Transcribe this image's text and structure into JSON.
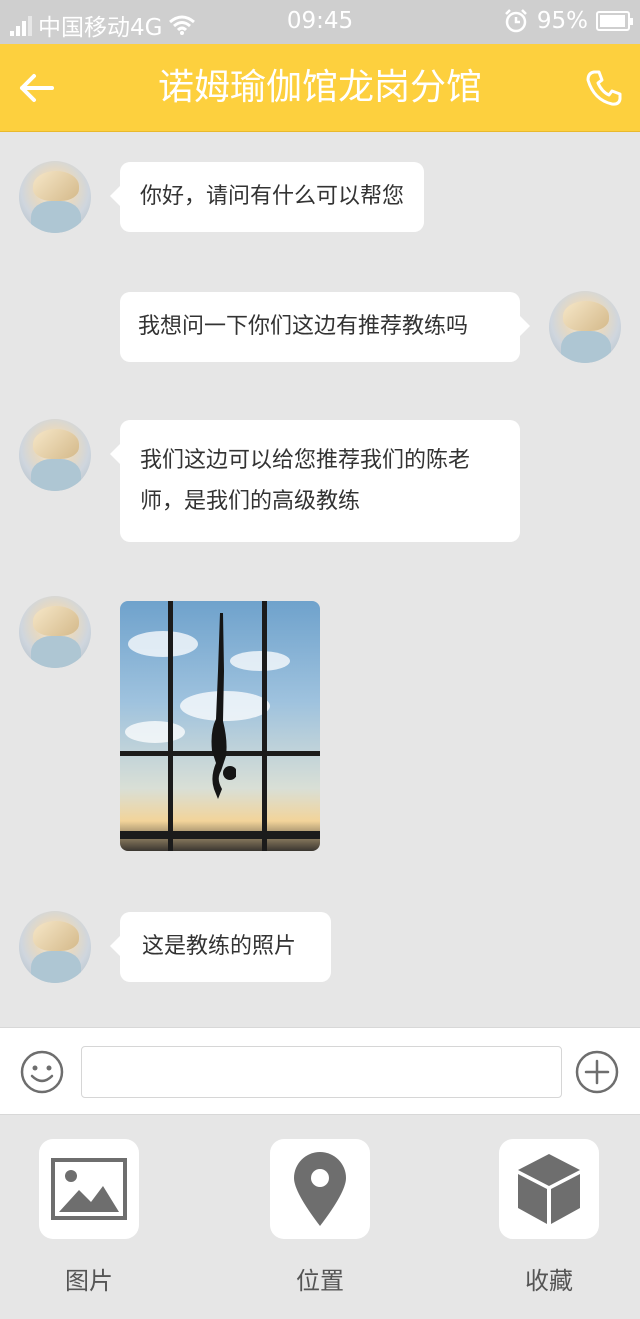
{
  "status_bar": {
    "carrier": "中国移动4G",
    "time": "09:45",
    "battery": "95%",
    "battery_level": 0.95
  },
  "header": {
    "title": "诺姆瑜伽馆龙岗分馆",
    "back_icon": "arrow-left-icon",
    "call_icon": "phone-icon"
  },
  "messages": [
    {
      "side": "left",
      "type": "text",
      "text": "你好，请问有什么可以帮您"
    },
    {
      "side": "right",
      "type": "text",
      "text": "我想问一下你们这边有推荐教练吗"
    },
    {
      "side": "left",
      "type": "text",
      "text": "我们这边可以给您推荐我们的陈老师，是我们的高级教练"
    },
    {
      "side": "left",
      "type": "image",
      "image": "yoga-handstand-photo"
    },
    {
      "side": "left",
      "type": "text",
      "text": "这是教练的照片"
    }
  ],
  "input_bar": {
    "emoji_icon": "smiley-icon",
    "value": "",
    "plus_icon": "plus-circle-icon"
  },
  "tray": [
    {
      "label": "图片",
      "icon": "image-icon"
    },
    {
      "label": "位置",
      "icon": "location-pin-icon"
    },
    {
      "label": "收藏",
      "icon": "box-icon"
    }
  ],
  "colors": {
    "header": "#fdd03e",
    "chat_background": "#e6e6e6",
    "bubble": "#ffffff",
    "icon_gray": "#6e6e6e"
  }
}
